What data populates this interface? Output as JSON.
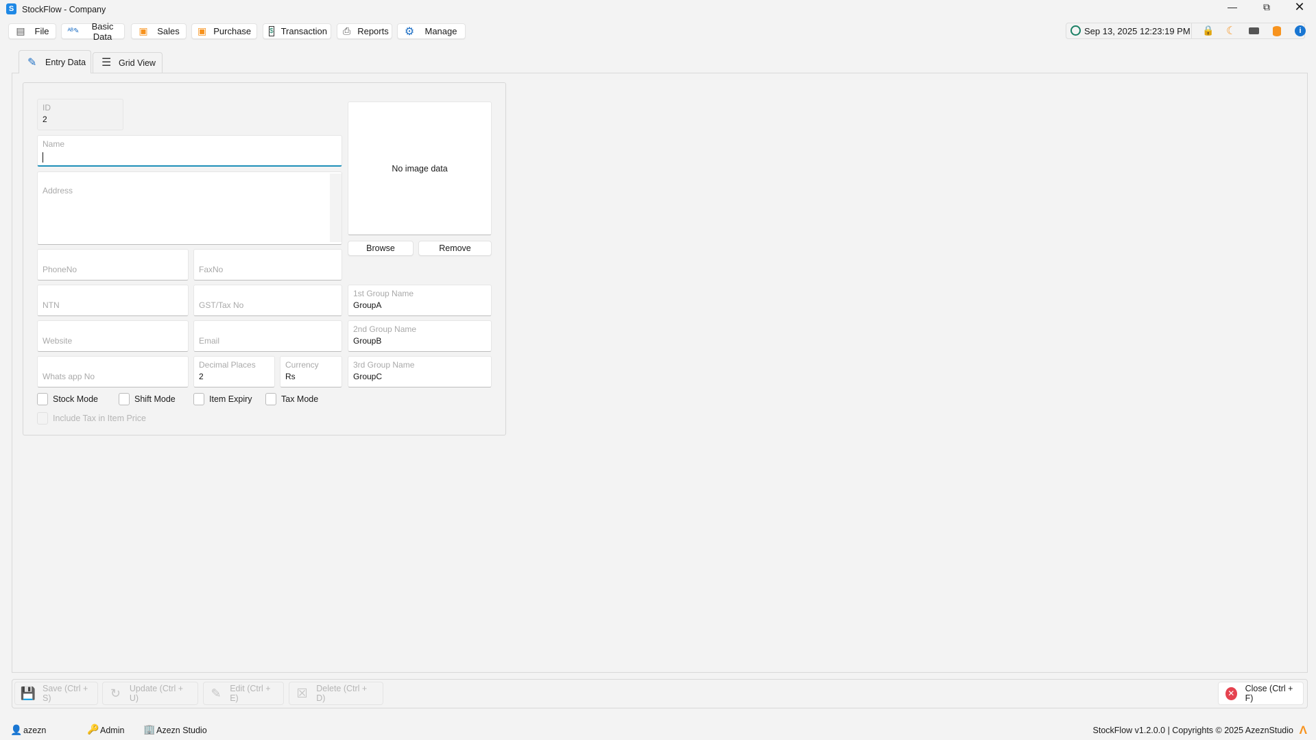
{
  "window": {
    "title": "StockFlow - Company",
    "app_icon_letter": "S"
  },
  "menu": [
    {
      "label": "File",
      "icon": "document-icon"
    },
    {
      "label": "Basic Data",
      "icon": "spellcheck-icon"
    },
    {
      "label": "Sales",
      "icon": "sales-cart-icon"
    },
    {
      "label": "Purchase",
      "icon": "purchase-cart-icon"
    },
    {
      "label": "Transaction",
      "icon": "dollar-doc-icon"
    },
    {
      "label": "Reports",
      "icon": "printer-icon"
    },
    {
      "label": "Manage",
      "icon": "gear-icon"
    }
  ],
  "status_panel": {
    "datetime": "Sep 13, 2025 12:23:19 PM"
  },
  "tabs": [
    {
      "label": "Entry Data",
      "active": true
    },
    {
      "label": "Grid View",
      "active": false
    }
  ],
  "form": {
    "id": {
      "label": "ID",
      "value": "2"
    },
    "name": {
      "placeholder": "Name",
      "value": ""
    },
    "address": {
      "placeholder": "Address"
    },
    "phone": {
      "placeholder": "PhoneNo"
    },
    "fax": {
      "placeholder": "FaxNo"
    },
    "ntn": {
      "placeholder": "NTN"
    },
    "gst": {
      "placeholder": "GST/Tax No"
    },
    "website": {
      "placeholder": "Website"
    },
    "email": {
      "placeholder": "Email"
    },
    "whatsapp": {
      "placeholder": "Whats app No"
    },
    "decimal": {
      "label": "Decimal Places",
      "value": "2"
    },
    "currency": {
      "label": "Currency",
      "value": "Rs"
    },
    "group1": {
      "label": "1st Group Name",
      "value": "GroupA"
    },
    "group2": {
      "label": "2nd Group Name",
      "value": "GroupB"
    },
    "group3": {
      "label": "3rd Group Name",
      "value": "GroupC"
    },
    "image": {
      "empty_text": "No image data",
      "browse": "Browse",
      "remove": "Remove"
    },
    "checks": [
      {
        "label": "Stock Mode",
        "checked": false
      },
      {
        "label": "Shift Mode",
        "checked": false
      },
      {
        "label": "Item Expiry",
        "checked": false
      },
      {
        "label": "Tax Mode",
        "checked": false
      }
    ],
    "include_tax": {
      "label": "Include Tax in Item Price",
      "checked": false,
      "disabled": true
    }
  },
  "toolbar": {
    "save": "Save (Ctrl + S)",
    "update": "Update (Ctrl + U)",
    "edit": "Edit (Ctrl + E)",
    "delete": "Delete (Ctrl + D)",
    "close": "Close (Ctrl + F)"
  },
  "statusbar": {
    "user": "azezn",
    "role": "Admin",
    "company": "Azezn Studio",
    "copyright": "StockFlow v1.2.0.0 | Copyrights © 2025 AzeznStudio"
  },
  "colors": {
    "accent": "#1e8fb8",
    "orange": "#f7931e",
    "close_red": "#e5424f",
    "info_blue": "#1976d2",
    "clock_green": "#1a7f64"
  }
}
